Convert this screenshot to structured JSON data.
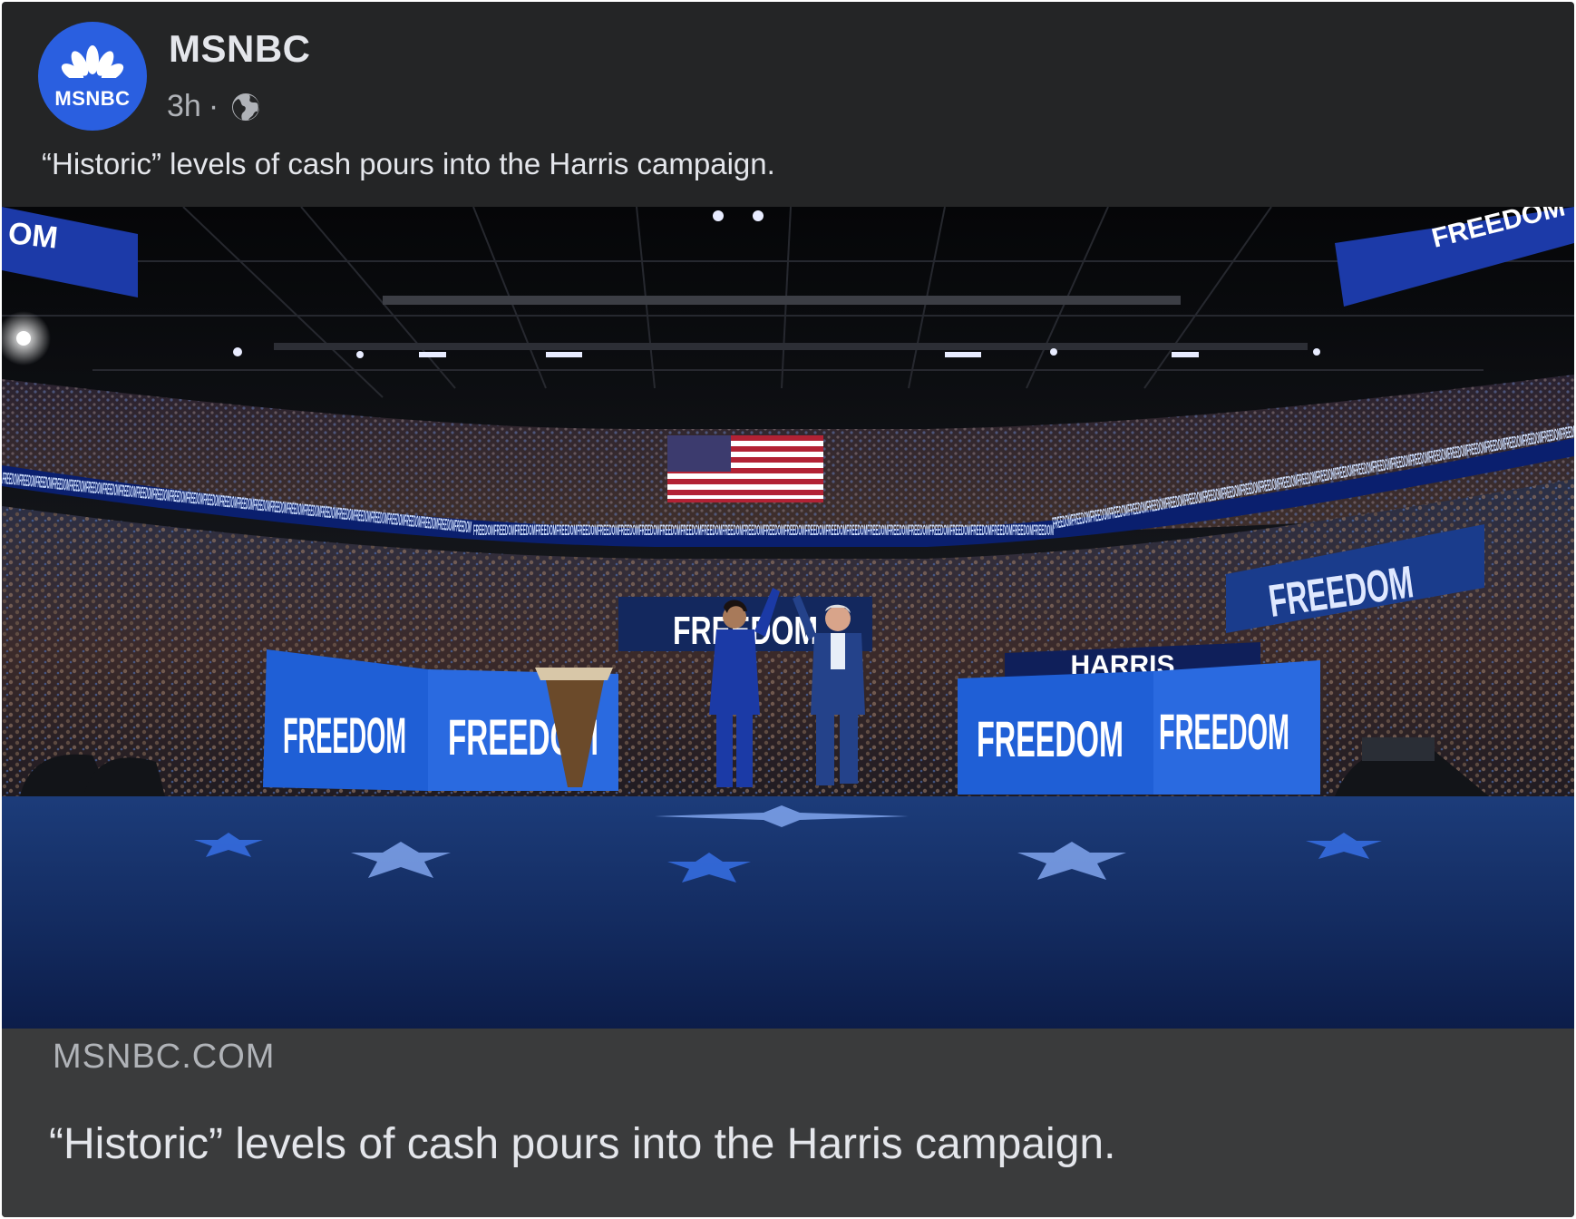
{
  "post": {
    "page_name": "MSNBC",
    "avatar_text": "MSNBC",
    "timestamp": "3h",
    "separator": "·",
    "audience_icon": "globe-icon",
    "text": "“Historic” levels of cash pours into the Harris campaign."
  },
  "photo": {
    "signs": {
      "freedom": "FREEDOM",
      "harris": "HARRIS",
      "ribbon": "FREEDOMFREEDOMFREEDOMFREEDOMFREEDOMFREEDOMFREEDOMFREEDOMFREEDOMFREEDOMFREEDOMFREEDOMFREEDOMFREEDOMFREEDOMFREEDOMFREEDOMFREEDOMFREEDOMFREEDOMFREEDOMFREEDOMFREEDOMFREEDOMFREEDOMFREEDOMFREEDOMFREEDOM"
    }
  },
  "link": {
    "domain": "MSNBC.COM",
    "title": "“Historic” levels of cash pours into the Harris campaign."
  }
}
